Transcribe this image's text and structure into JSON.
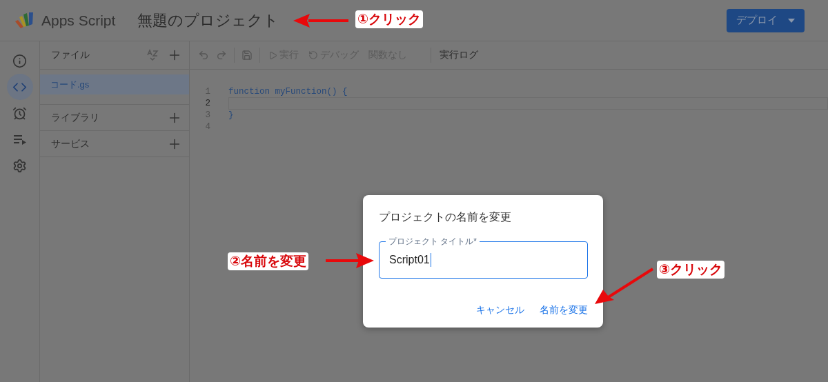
{
  "header": {
    "app_name": "Apps Script",
    "project_title": "無題のプロジェクト",
    "deploy_button": "デプロイ"
  },
  "rail": [
    {
      "kind": "info",
      "selected": false
    },
    {
      "kind": "editor",
      "selected": true
    },
    {
      "kind": "triggers",
      "selected": false
    },
    {
      "kind": "executions",
      "selected": false
    },
    {
      "kind": "settings",
      "selected": false
    }
  ],
  "files_panel": {
    "title": "ファイル",
    "files": [
      {
        "name": "コード.gs",
        "selected": true
      }
    ],
    "sections": [
      "ライブラリ",
      "サービス"
    ]
  },
  "toolbar": [
    {
      "kind": "run",
      "label": "実行",
      "disabled": true
    },
    {
      "kind": "debug",
      "label": "デバッグ",
      "disabled": true
    },
    {
      "kind": "function",
      "label": "関数なし",
      "disabled": true
    },
    {
      "kind": "log",
      "label": "実行ログ",
      "disabled": false
    }
  ],
  "editor": {
    "lines": [
      {
        "number": "1",
        "code": "function myFunction() {",
        "current": false
      },
      {
        "number": "2",
        "current": true
      },
      {
        "number": "3",
        "code": "}",
        "current": false
      },
      {
        "number": "4",
        "current": false
      }
    ]
  },
  "dialog": {
    "title": "プロジェクトの名前を変更",
    "field": {
      "label": "プロジェクト タイトル*",
      "value": "Script01"
    },
    "buttons": [
      "キャンセル",
      "名前を変更"
    ]
  },
  "annotations": [
    {
      "text": "①クリック",
      "kind": "left"
    },
    {
      "text": "②名前を変更",
      "kind": "right"
    },
    {
      "text": "③クリック",
      "kind": "down-left"
    }
  ]
}
